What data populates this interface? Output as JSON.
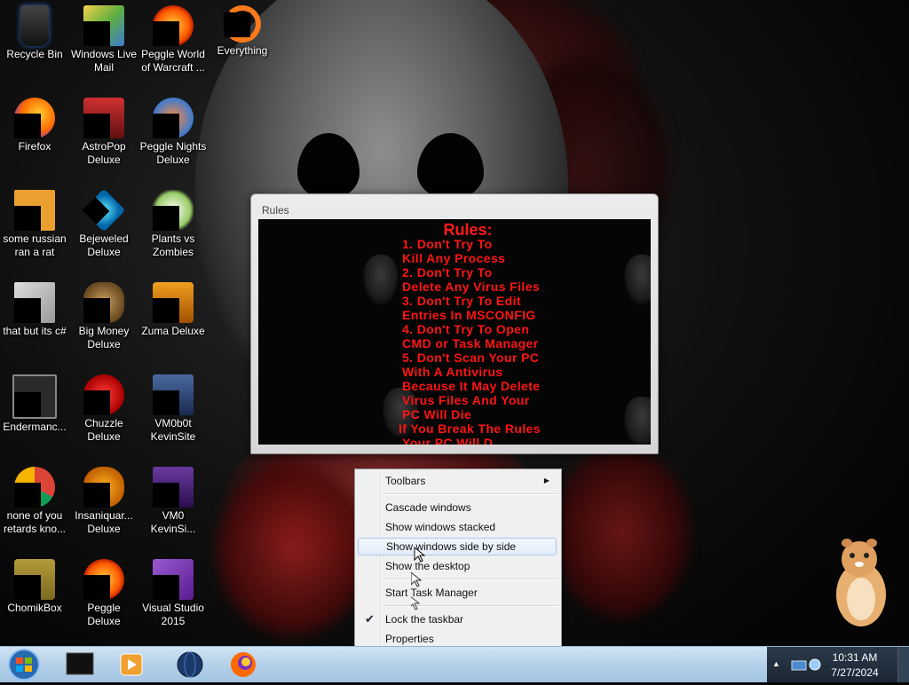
{
  "desktop_icons": [
    {
      "label": "Recycle Bin",
      "icon": "recycle-bin-icon"
    },
    {
      "label": "Windows Live Mail",
      "icon": "windows-live-mail-icon"
    },
    {
      "label": "Peggle World of Warcraft ...",
      "icon": "peggle-wow-icon"
    },
    {
      "label": "Everything",
      "icon": "everything-search-icon"
    },
    {
      "label": "Firefox",
      "icon": "firefox-icon"
    },
    {
      "label": "AstroPop Deluxe",
      "icon": "astropop-icon"
    },
    {
      "label": "Peggle Nights Deluxe",
      "icon": "peggle-nights-icon"
    },
    {
      "label": "some russian ran a rat",
      "icon": "file-icon"
    },
    {
      "label": "Bejeweled Deluxe",
      "icon": "bejeweled-icon"
    },
    {
      "label": "Plants vs Zombies",
      "icon": "plants-vs-zombies-icon"
    },
    {
      "label": "that but its c#",
      "icon": "document-stack-icon"
    },
    {
      "label": "Big Money Deluxe",
      "icon": "big-money-icon"
    },
    {
      "label": "Zuma Deluxe",
      "icon": "zuma-icon"
    },
    {
      "label": "Endermanc...",
      "icon": "console-app-icon"
    },
    {
      "label": "Chuzzle Deluxe",
      "icon": "chuzzle-icon"
    },
    {
      "label": "VM0b0t KevinSite",
      "icon": "vm-icon"
    },
    {
      "label": "none of you retards kno...",
      "icon": "chrome-icon"
    },
    {
      "label": "Insaniquar... Deluxe",
      "icon": "insaniquarium-icon"
    },
    {
      "label": "VM0 KevinSi...",
      "icon": "vm-icon"
    },
    {
      "label": "ChomikBox",
      "icon": "chomikbox-icon"
    },
    {
      "label": "Peggle Deluxe",
      "icon": "peggle-icon"
    },
    {
      "label": "Visual Studio 2015",
      "icon": "visual-studio-icon"
    }
  ],
  "rules_window": {
    "title": "Rules",
    "heading": "Rules:",
    "lines": [
      "1. Don't Try To",
      "Kill Any Process",
      "2. Don't Try To",
      "Delete Any Virus Files",
      "3. Don't Try To Edit",
      "Entries In MSCONFIG",
      "4. Don't Try To Open",
      "CMD or Task Manager",
      "5. Don't Scan Your PC",
      "With A Antivirus",
      "Because It May Delete",
      "Virus Files And Your",
      "PC Will Die",
      "If You Break The Rules",
      "Your PC Will D..."
    ]
  },
  "context_menu": {
    "items": [
      {
        "label": "Toolbars",
        "submenu": true
      },
      {
        "label": "Cascade windows"
      },
      {
        "label": "Show windows stacked"
      },
      {
        "label": "Show windows side by side",
        "hovered": true
      },
      {
        "label": "Show the desktop"
      },
      {
        "label": "Start Task Manager"
      },
      {
        "label": "Lock the taskbar",
        "checked": true
      },
      {
        "label": "Properties"
      }
    ]
  },
  "taskbar": {
    "pinned": [
      "cmd-icon",
      "media-player-icon",
      "globe-icon",
      "firefox-icon"
    ],
    "clock_time": "10:31 AM",
    "clock_date": "7/27/2024"
  },
  "colors": {
    "rules_text": "#ff1414",
    "taskbar": "#b5d1ea"
  }
}
